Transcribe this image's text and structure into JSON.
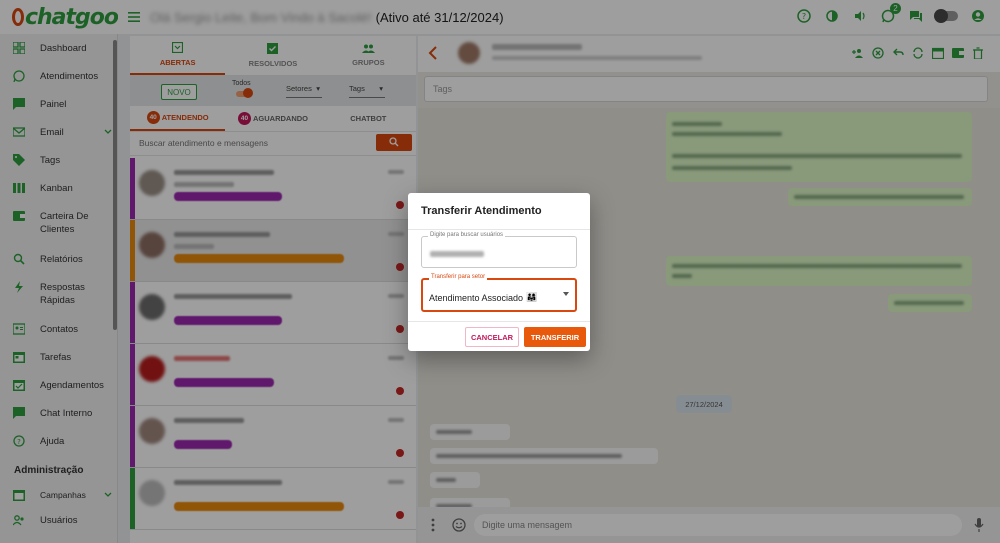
{
  "app": {
    "logo_text": "chatgoo",
    "blurred_greeting": "Olá Sergio Leite, Bom Vindo à Sacolé!",
    "active_until": "(Ativo até 31/12/2024)",
    "notifications_count": "2"
  },
  "sidebar": {
    "items": [
      {
        "label": "Dashboard",
        "icon": "dashboard-icon"
      },
      {
        "label": "Atendimentos",
        "icon": "whatsapp-icon"
      },
      {
        "label": "Painel",
        "icon": "panel-icon"
      },
      {
        "label": "Email",
        "icon": "email-icon"
      },
      {
        "label": "Tags",
        "icon": "tag-icon"
      },
      {
        "label": "Kanban",
        "icon": "kanban-icon"
      },
      {
        "label": "Carteira De Clientes",
        "icon": "wallet-icon"
      },
      {
        "label": "Relatórios",
        "icon": "search-icon"
      },
      {
        "label": "Respostas Rápidas",
        "icon": "flash-icon"
      },
      {
        "label": "Contatos",
        "icon": "contacts-icon"
      },
      {
        "label": "Tarefas",
        "icon": "calendar-icon"
      },
      {
        "label": "Agendamentos",
        "icon": "schedule-icon"
      },
      {
        "label": "Chat Interno",
        "icon": "chat-icon"
      },
      {
        "label": "Ajuda",
        "icon": "help-icon"
      }
    ],
    "section_admin": "Administração",
    "admin_items": [
      {
        "label": "Campanhas",
        "icon": "campaign-icon"
      },
      {
        "label": "Usuários",
        "icon": "users-icon"
      }
    ]
  },
  "tickets_panel": {
    "tabs": [
      {
        "label": "ABERTAS"
      },
      {
        "label": "RESOLVIDOS"
      },
      {
        "label": "GRUPOS"
      }
    ],
    "novo_button": "NOVO",
    "todos_label": "Todos",
    "setores_label": "Setores",
    "tags_label": "Tags",
    "subtabs": [
      {
        "label": "ATENDENDO",
        "count": "40"
      },
      {
        "label": "AGUARDANDO",
        "count": "40"
      },
      {
        "label": "CHATBOT"
      }
    ],
    "search_placeholder": "Buscar atendimento e mensagens"
  },
  "chat": {
    "tags_placeholder": "Tags",
    "date_chip": "27/12/2024",
    "composer_placeholder": "Digite uma mensagem"
  },
  "dialog": {
    "title": "Transferir Atendimento",
    "user_label": "Digite para buscar usuários",
    "user_value_blurred": "Tobson Gomes",
    "sector_label": "Transferir para setor",
    "sector_value": "Atendimento Associado",
    "sector_emoji": "👨‍👩‍👧",
    "cancel_label": "CANCELAR",
    "transfer_label": "TRANSFERIR"
  },
  "colors": {
    "brand_orange": "#d9480f",
    "brand_green": "#2e9e40",
    "tag_purple": "#9c27b0",
    "tag_orange": "#e8890c",
    "alert_red": "#c62828"
  }
}
